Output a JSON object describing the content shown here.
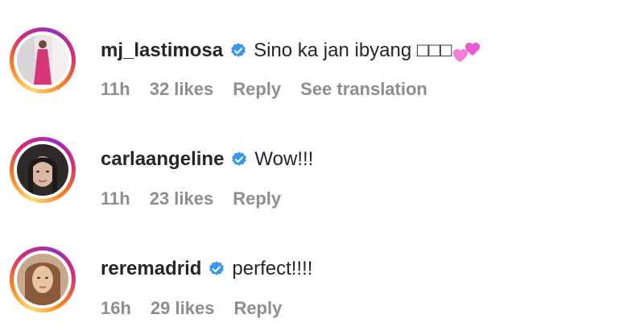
{
  "comments": [
    {
      "username": "mj_lastimosa",
      "text": "Sino ka jan ibyang □□□",
      "emoji_icon": "two-hearts-icon",
      "time": "11h",
      "likes": "32 likes",
      "reply": "Reply",
      "translation": "See translation"
    },
    {
      "username": "carlaangeline",
      "text": "Wow!!!",
      "time": "11h",
      "likes": "23 likes",
      "reply": "Reply"
    },
    {
      "username": "reremadrid",
      "text": "perfect!!!!",
      "time": "16h",
      "likes": "29 likes",
      "reply": "Reply"
    }
  ],
  "colors": {
    "verified": "#3897f0",
    "meta": "#8e8e8e",
    "text": "#262626",
    "heart": "#f26ad0"
  }
}
